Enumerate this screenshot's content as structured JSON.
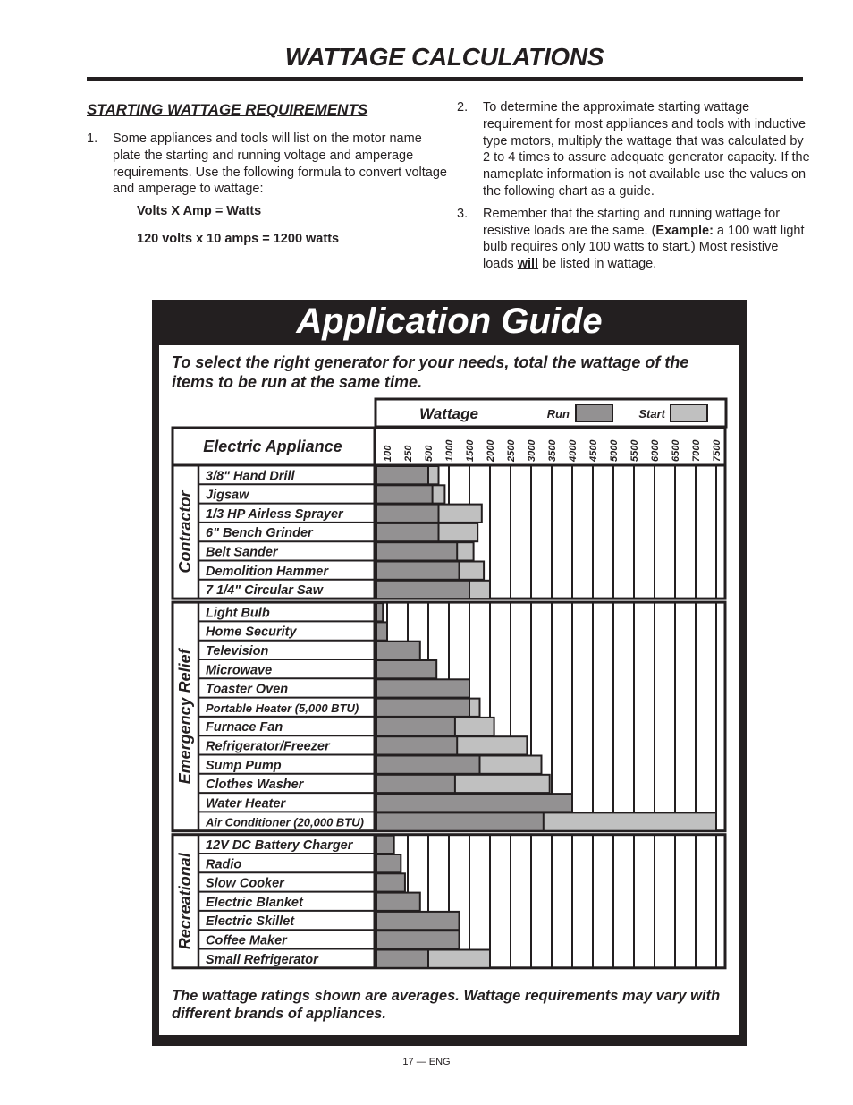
{
  "page": {
    "title": "WATTAGE CALCULATIONS",
    "section_heading": "STARTING WATTAGE REQUIREMENTS",
    "items": [
      {
        "num": "1.",
        "text": "Some appliances and tools will list on the motor name plate the starting and running voltage and amperage requirements. Use the following formula to convert voltage and amperage to wattage:"
      },
      {
        "num": "2.",
        "text": "To determine the approximate starting wattage requirement for most appliances and tools with inductive type motors, multiply the wattage that was calculated by 2 to 4 times to assure adequate generator capacity. If the nameplate information is not available use the values on the following chart as a guide."
      },
      {
        "num": "3.",
        "text_pre": "Remember that the starting and running wattage for resistive loads are the same. (",
        "text_bold": "Example:",
        "text_mid": " a 100 watt light bulb requires only 100 watts to start.) Most resistive loads ",
        "text_underline": "will",
        "text_post": " be listed in wattage."
      }
    ],
    "formula_1": "Volts X Amp = Watts",
    "formula_2": "120 volts x 10 amps = 1200 watts",
    "page_number": "17 — ENG"
  },
  "guide": {
    "title": "Application Guide",
    "intro": "To select the right generator for your needs, total the wattage of the items to be run at the same time.",
    "footnote": "The wattage ratings shown are averages. Wattage requirements may vary with different brands of appliances.",
    "colors": {
      "run": "#939192",
      "start": "#c0c0c0",
      "line": "#231f20"
    }
  },
  "chart_data": {
    "type": "bar",
    "orientation": "horizontal-stacked",
    "title": "Application Guide",
    "xlabel": "Wattage",
    "ylabel": "Electric Appliance",
    "x_ticks": [
      100,
      250,
      500,
      1000,
      1500,
      2000,
      2500,
      3000,
      3500,
      4000,
      4500,
      5000,
      5500,
      6000,
      6500,
      7000,
      7500
    ],
    "xlim": [
      0,
      7500
    ],
    "legend": [
      {
        "name": "Run",
        "color": "#939192"
      },
      {
        "name": "Start",
        "color": "#c0c0c0"
      }
    ],
    "legend_position": "top",
    "groups": [
      {
        "name": "Contractor",
        "items": [
          {
            "label": "3/8\" Hand Drill",
            "run": 500,
            "start": 750
          },
          {
            "label": "Jigsaw",
            "run": 600,
            "start": 900
          },
          {
            "label": "1/3 HP Airless Sprayer",
            "run": 750,
            "start": 1800
          },
          {
            "label": "6\" Bench Grinder",
            "run": 750,
            "start": 1700
          },
          {
            "label": "Belt Sander",
            "run": 1200,
            "start": 1600
          },
          {
            "label": "Demolition Hammer",
            "run": 1250,
            "start": 1850
          },
          {
            "label": "7 1/4\" Circular Saw",
            "run": 1500,
            "start": 2000
          }
        ]
      },
      {
        "name": "Emergency Relief",
        "items": [
          {
            "label": "Light Bulb",
            "run": 60,
            "start": null
          },
          {
            "label": "Home Security",
            "run": 100,
            "start": null
          },
          {
            "label": "Television",
            "run": 400,
            "start": null
          },
          {
            "label": "Microwave",
            "run": 700,
            "start": null
          },
          {
            "label": "Toaster Oven",
            "run": 1500,
            "start": null
          },
          {
            "label": "Portable Heater (5,000 BTU)",
            "run": 1500,
            "start": 1750
          },
          {
            "label": "Furnace Fan",
            "run": 1150,
            "start": 2100
          },
          {
            "label": "Refrigerator/Freezer",
            "run": 1200,
            "start": 2900
          },
          {
            "label": "Sump Pump",
            "run": 1750,
            "start": 3250
          },
          {
            "label": "Clothes Washer",
            "run": 1150,
            "start": 3450
          },
          {
            "label": "Water Heater",
            "run": 4000,
            "start": null
          },
          {
            "label": "Air Conditioner (20,000 BTU)",
            "run": 3300,
            "start": 7500
          }
        ]
      },
      {
        "name": "Recreational",
        "items": [
          {
            "label": "12V DC Battery Charger",
            "run": 150,
            "start": null
          },
          {
            "label": "Radio",
            "run": 200,
            "start": null
          },
          {
            "label": "Slow Cooker",
            "run": 230,
            "start": null
          },
          {
            "label": "Electric Blanket",
            "run": 400,
            "start": null
          },
          {
            "label": "Electric Skillet",
            "run": 1250,
            "start": null
          },
          {
            "label": "Coffee Maker",
            "run": 1250,
            "start": null
          },
          {
            "label": "Small Refrigerator",
            "run": 500,
            "start": 2000
          }
        ]
      }
    ],
    "grid": true
  }
}
